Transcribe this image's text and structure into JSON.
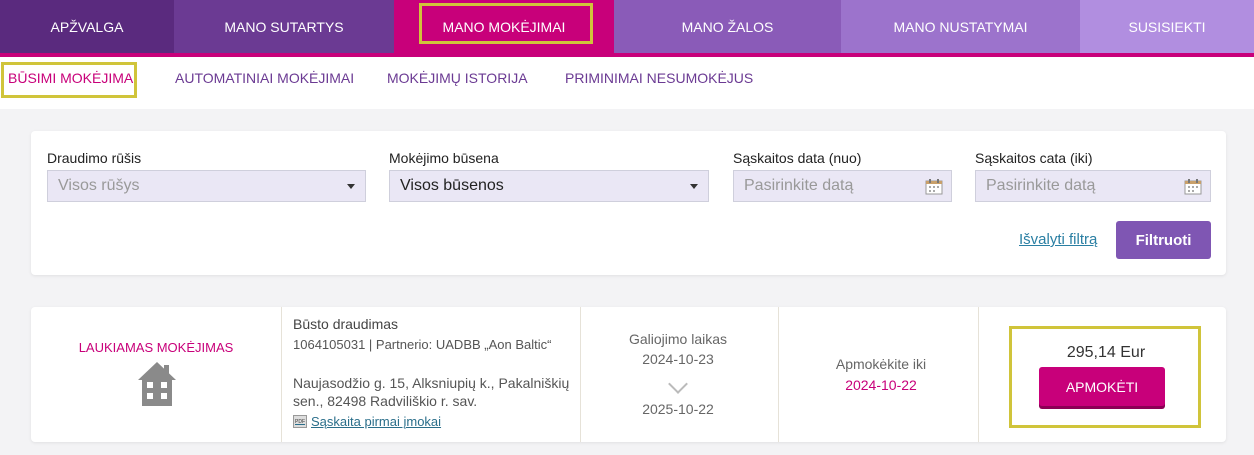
{
  "topnav": [
    {
      "label": "APŽVALGA"
    },
    {
      "label": "MANO SUTARTYS"
    },
    {
      "label": "MANO MOKĖJIMAI"
    },
    {
      "label": "MANO ŽALOS"
    },
    {
      "label": "MANO NUSTATYMAI"
    },
    {
      "label": "SUSISIEKTI"
    }
  ],
  "subnav": [
    {
      "label": "BŪSIMI MOKĖJIMAI"
    },
    {
      "label": "AUTOMATINIAI MOKĖJIMAI"
    },
    {
      "label": "MOKĖJIMŲ ISTORIJA"
    },
    {
      "label": "PRIMINIMAI NESUMOKĖJUS"
    }
  ],
  "filters": {
    "insurance_type_label": "Draudimo rūšis",
    "insurance_type_value": "Visos rūšys",
    "payment_status_label": "Mokėjimo būsena",
    "payment_status_value": "Visos būsenos",
    "invoice_from_label": "Sąskaitos data (nuo)",
    "invoice_from_placeholder": "Pasirinkite datą",
    "invoice_to_label": "Sąskaitos cata (iki)",
    "invoice_to_placeholder": "Pasirinkite datą",
    "clear_label": "Išvalyti filtrą",
    "filter_label": "Filtruoti"
  },
  "payment": {
    "status": "LAUKIAMAS MOKĖJIMAS",
    "insurance_title": "Būsto draudimas",
    "policy_meta": "1064105031 | Partnerio: UADBB „Aon Baltic“",
    "address": "Naujasodžio g. 15, Alksniupių k., Pakalniškių sen., 82498 Radviliškio r. sav.",
    "invoice_link": "Sąskaita pirmai įmokai",
    "validity_label": "Galiojimo laikas",
    "validity_from": "2024-10-23",
    "validity_to": "2025-10-22",
    "pay_by_label": "Apmokėkite iki",
    "pay_by_date": "2024-10-22",
    "amount": "295,14 Eur",
    "pay_button": "APMOKĖTI"
  },
  "colors": {
    "accent": "#c8007a",
    "purple": "#7f56b3",
    "highlight": "#d0c43a"
  }
}
